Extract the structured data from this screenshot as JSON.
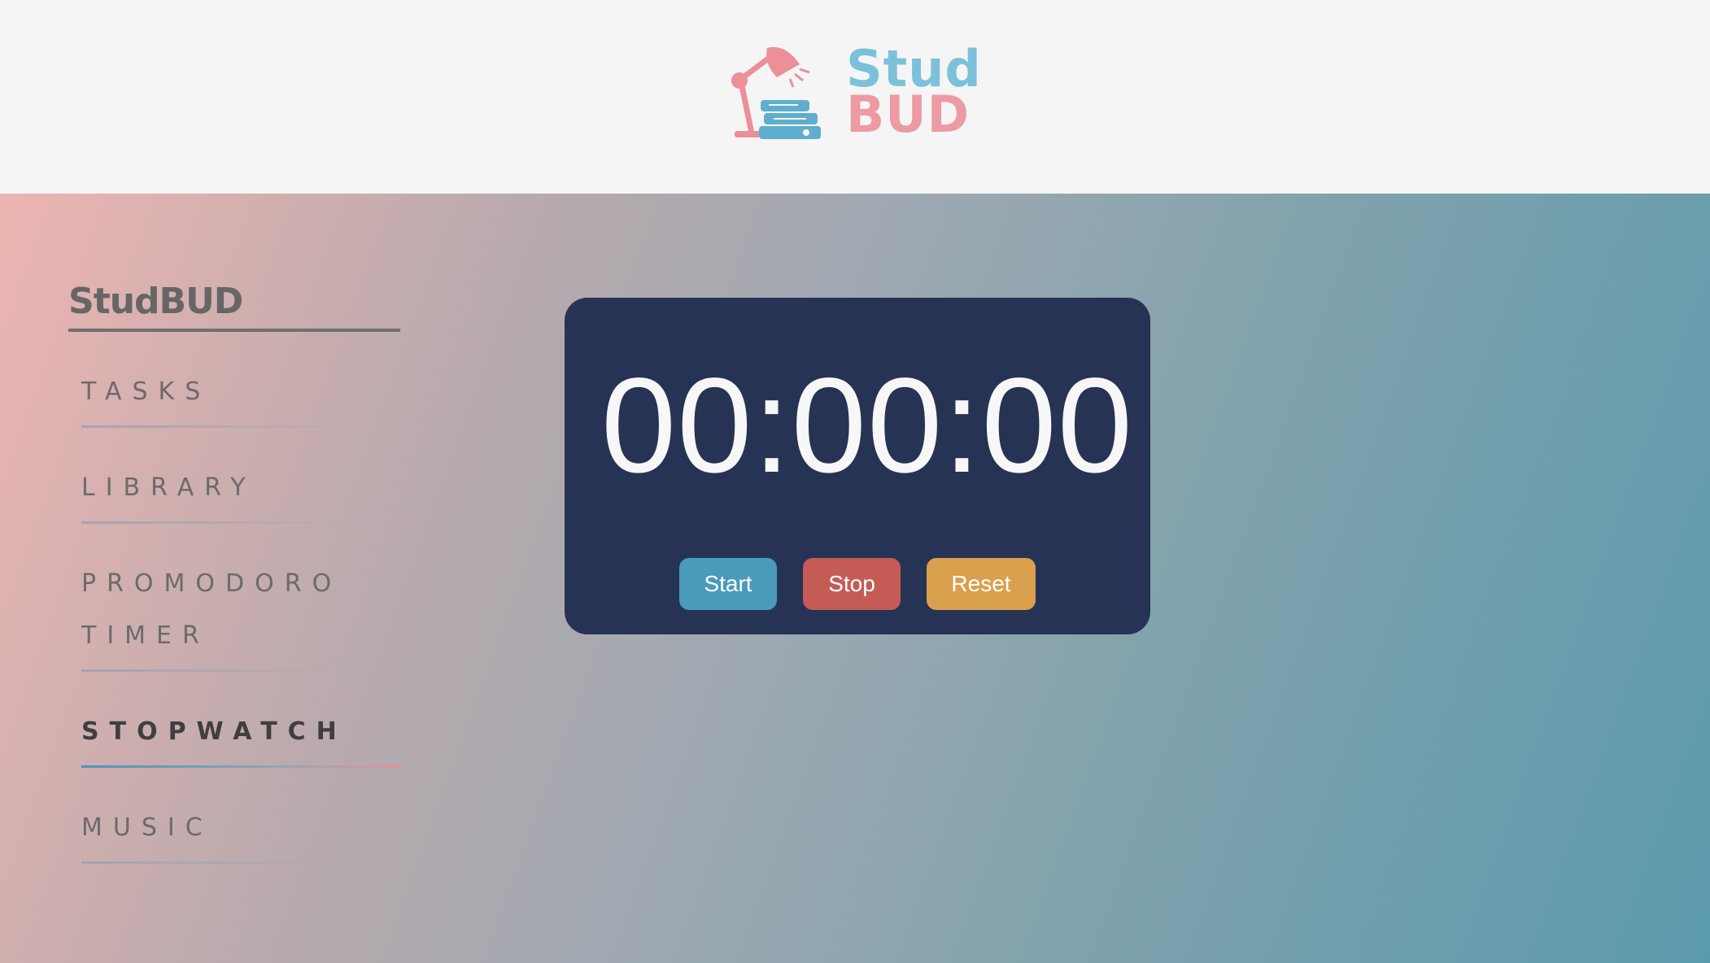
{
  "header": {
    "logo_line1": "Stud",
    "logo_line2": "BUD",
    "logo_icon": "desk-lamp-books-icon"
  },
  "sidebar": {
    "brand": "StudBUD",
    "items": [
      {
        "label": "TASKS",
        "active": false
      },
      {
        "label": "LIBRARY",
        "active": false
      },
      {
        "label": "PROMODORO",
        "label2": "TIMER",
        "active": false
      },
      {
        "label": "STOPWATCH",
        "active": true
      },
      {
        "label": "MUSIC",
        "active": false
      }
    ]
  },
  "stopwatch": {
    "time": "00:00:00",
    "start_label": "Start",
    "stop_label": "Stop",
    "reset_label": "Reset"
  },
  "colors": {
    "header_bg": "#f5f5f5",
    "panel_bg": "#263354",
    "start": "#4a9aba",
    "stop": "#c45c55",
    "reset": "#d9a04e",
    "logo_blue": "#7cc1d9",
    "logo_pink": "#ec9aa4"
  }
}
